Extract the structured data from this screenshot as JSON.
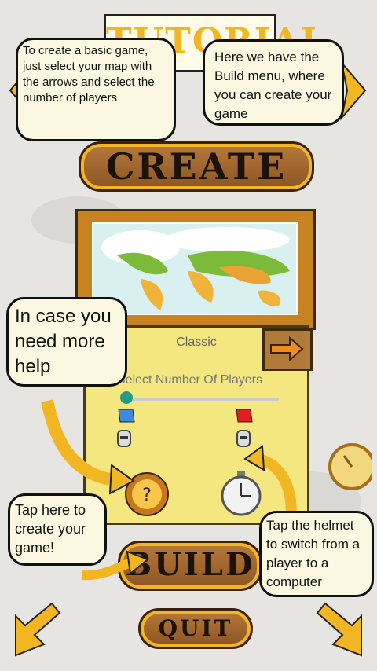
{
  "header": {
    "title": "TUTORIAL"
  },
  "create_plank": {
    "label": "CREATE"
  },
  "map_panel": {
    "map_name": "Classic"
  },
  "players": {
    "heading": "Select Number Of Players"
  },
  "build_plank": {
    "label": "BUILD"
  },
  "quit_plank": {
    "label": "QUIT"
  },
  "tips": {
    "basic_game": "To create a basic game, just select your map with the arrows and select the number of players",
    "build_menu": "Here we have the Build menu, where you can create your game",
    "more_help": "In case you need more help",
    "tap_here": "Tap here to create your game!",
    "helmet": "Tap the helmet to switch from a player to a computer"
  },
  "colors": {
    "accent": "#f3b623",
    "wood": "#a0652d",
    "panel": "#f4e77f"
  }
}
